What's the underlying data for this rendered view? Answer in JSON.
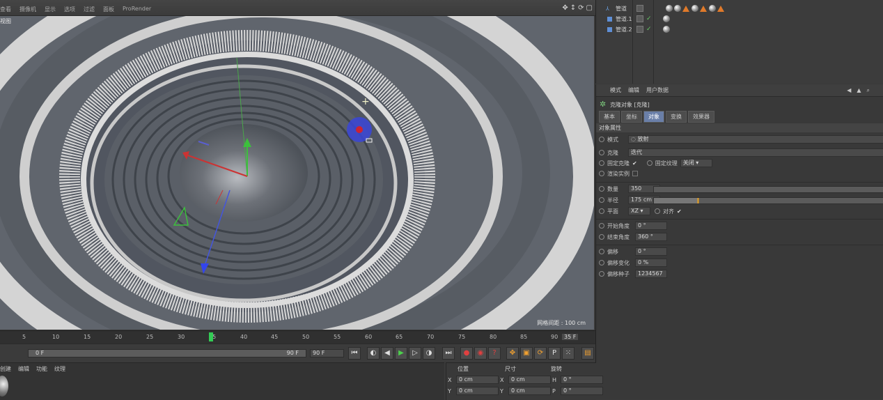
{
  "menu": [
    "查看",
    "摄像机",
    "显示",
    "选项",
    "过滤",
    "面板",
    "ProRender"
  ],
  "viewport": {
    "label": "视图",
    "grid_spacing": "网格间距 : 100 cm"
  },
  "objects": [
    {
      "name": "管道"
    },
    {
      "name": "管道.1"
    },
    {
      "name": "管道.2"
    }
  ],
  "attributes": {
    "menu": [
      "模式",
      "编辑",
      "用户数据"
    ],
    "title": "克隆对象 [克隆]",
    "tabs": [
      "基本",
      "坐标",
      "对象",
      "变换",
      "效果器"
    ],
    "active_tab": "对象",
    "section": "对象属性",
    "mode_label": "模式",
    "mode_value": "放射",
    "clones_label": "克隆",
    "clones_value": "迭代",
    "fix_clone_label": "固定克隆",
    "fix_texture_label": "固定纹理",
    "fix_texture_value": "关闭",
    "render_instances_label": "渲染实例",
    "count_label": "数量",
    "count_value": "350",
    "radius_label": "半径",
    "radius_value": "175 cm",
    "plane_label": "平面",
    "plane_value": "XZ",
    "align_label": "对齐",
    "start_angle_label": "开始角度",
    "start_angle_value": "0 °",
    "end_angle_label": "结束角度",
    "end_angle_value": "360 °",
    "offset_label": "偏移",
    "offset_value": "0 °",
    "offset_var_label": "偏移变化",
    "offset_var_value": "0 %",
    "offset_seed_label": "偏移种子",
    "offset_seed_value": "1234567"
  },
  "timeline": {
    "ticks": [
      "5",
      "10",
      "15",
      "20",
      "25",
      "30",
      "35",
      "40",
      "45",
      "50",
      "55",
      "60",
      "65",
      "70",
      "75",
      "80",
      "85",
      "90"
    ],
    "current_frame": "35 F",
    "range_start": "0 F",
    "range_end": "90 F",
    "end_field": "90 F"
  },
  "materials": {
    "menu": [
      "创建",
      "编辑",
      "功能",
      "纹理"
    ]
  },
  "coords": {
    "headers": [
      "位置",
      "尺寸",
      "旋转"
    ],
    "rows": [
      {
        "a": "X",
        "av": "0 cm",
        "b": "X",
        "bv": "0 cm",
        "c": "H",
        "cv": "0 °"
      },
      {
        "a": "Y",
        "av": "0 cm",
        "b": "Y",
        "bv": "0 cm",
        "c": "P",
        "cv": "0 °"
      }
    ]
  },
  "colors": {
    "accent": "#6a7fa8",
    "playhead": "#33cc55",
    "viewport_bg": "#5e636b"
  }
}
